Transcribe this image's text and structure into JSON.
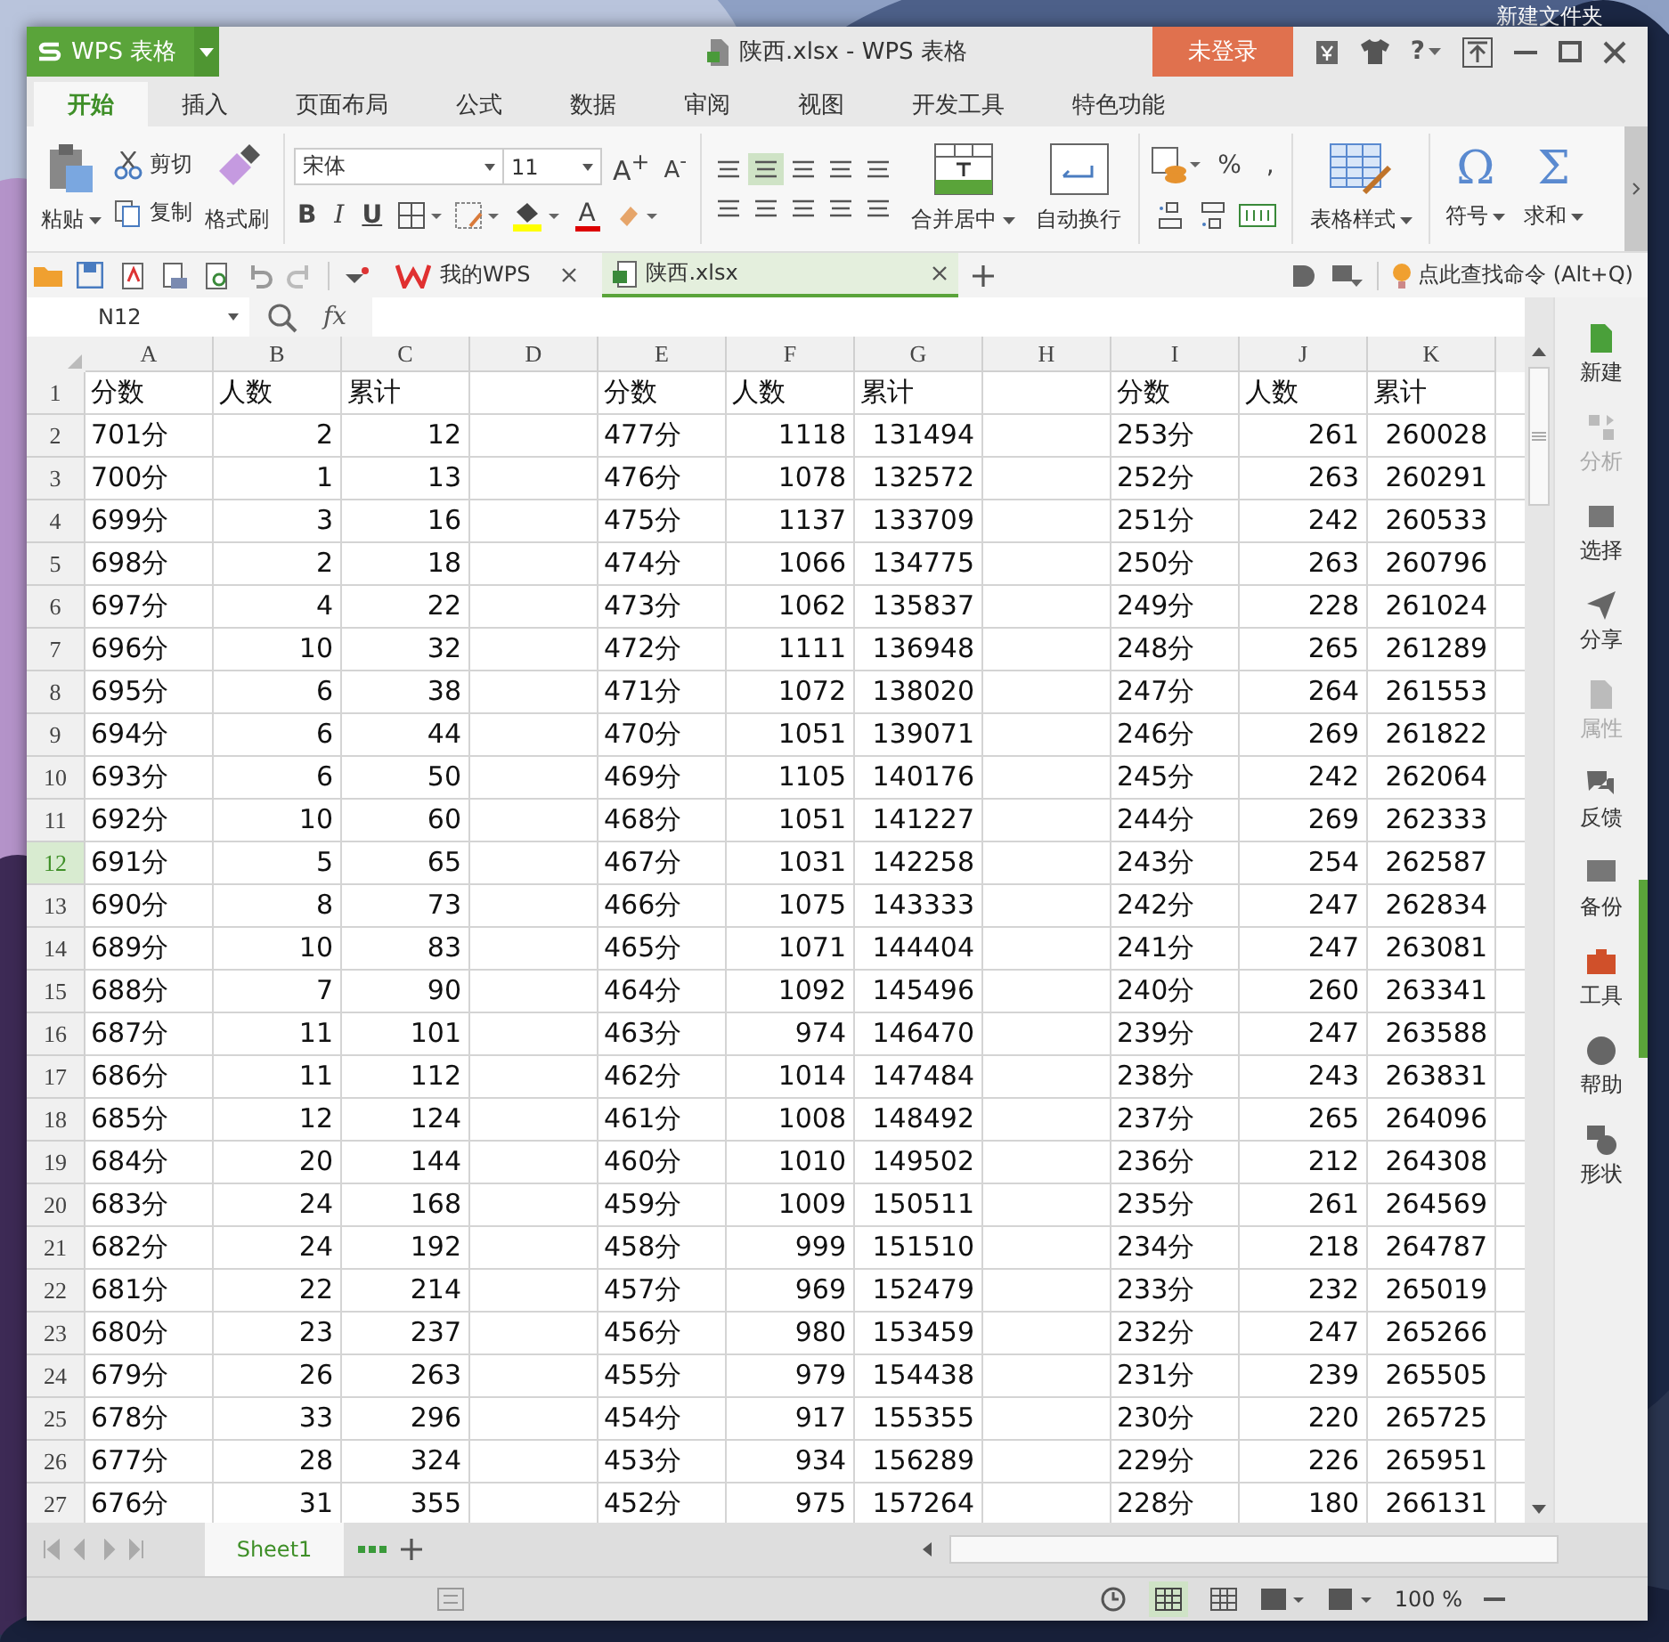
{
  "desktop": {
    "folder_label": "新建文件夹"
  },
  "window": {
    "app_button": "WPS 表格",
    "title": "陕西.xlsx - WPS 表格",
    "login": "未登录",
    "help": "?"
  },
  "ribbon_tabs": [
    {
      "label": "开始",
      "selected": true
    },
    {
      "label": "插入",
      "selected": false
    },
    {
      "label": "页面布局",
      "selected": false
    },
    {
      "label": "公式",
      "selected": false
    },
    {
      "label": "数据",
      "selected": false
    },
    {
      "label": "审阅",
      "selected": false
    },
    {
      "label": "视图",
      "selected": false
    },
    {
      "label": "开发工具",
      "selected": false
    },
    {
      "label": "特色功能",
      "selected": false
    }
  ],
  "ribbon": {
    "paste": "粘贴",
    "cut": "剪切",
    "copy": "复制",
    "format_painter": "格式刷",
    "font": "宋体",
    "font_size": "11",
    "grow": "A$^{+}$",
    "shrink": "A$^{-}$",
    "bold": "B",
    "italic": "I",
    "underline": "U",
    "font_color": "A",
    "merge": "合并居中",
    "wrap": "自动换行",
    "percent": "%",
    "comma": ",",
    "table_style": "表格样式",
    "symbol": "符号",
    "symbol_glyph": "Ω",
    "sum": "求和",
    "sum_glyph": "Σ"
  },
  "doc_tabs": [
    {
      "label": "我的WPS",
      "selected": false
    },
    {
      "label": "陕西.xlsx",
      "selected": true
    }
  ],
  "command_search": "点此查找命令 (Alt+Q)",
  "formula_bar": {
    "name_box": "N12",
    "fx": "fx"
  },
  "columns": [
    "A",
    "B",
    "C",
    "D",
    "E",
    "F",
    "G",
    "H",
    "I",
    "J",
    "K"
  ],
  "row_headers": [
    {
      "label": "1",
      "selected": false
    },
    {
      "label": "2",
      "selected": false
    },
    {
      "label": "3",
      "selected": false
    },
    {
      "label": "4",
      "selected": false
    },
    {
      "label": "5",
      "selected": false
    },
    {
      "label": "6",
      "selected": false
    },
    {
      "label": "7",
      "selected": false
    },
    {
      "label": "8",
      "selected": false
    },
    {
      "label": "9",
      "selected": false
    },
    {
      "label": "10",
      "selected": false
    },
    {
      "label": "11",
      "selected": false
    },
    {
      "label": "12",
      "selected": true
    },
    {
      "label": "13",
      "selected": false
    },
    {
      "label": "14",
      "selected": false
    },
    {
      "label": "15",
      "selected": false
    },
    {
      "label": "16",
      "selected": false
    },
    {
      "label": "17",
      "selected": false
    },
    {
      "label": "18",
      "selected": false
    },
    {
      "label": "19",
      "selected": false
    },
    {
      "label": "20",
      "selected": false
    },
    {
      "label": "21",
      "selected": false
    },
    {
      "label": "22",
      "selected": false
    },
    {
      "label": "23",
      "selected": false
    },
    {
      "label": "24",
      "selected": false
    },
    {
      "label": "25",
      "selected": false
    },
    {
      "label": "26",
      "selected": false
    },
    {
      "label": "27",
      "selected": false
    }
  ],
  "blocks": [
    {
      "headers": [
        "分数",
        "人数",
        "累计"
      ],
      "rows": [
        [
          "701分",
          "2",
          "12"
        ],
        [
          "700分",
          "1",
          "13"
        ],
        [
          "699分",
          "3",
          "16"
        ],
        [
          "698分",
          "2",
          "18"
        ],
        [
          "697分",
          "4",
          "22"
        ],
        [
          "696分",
          "10",
          "32"
        ],
        [
          "695分",
          "6",
          "38"
        ],
        [
          "694分",
          "6",
          "44"
        ],
        [
          "693分",
          "6",
          "50"
        ],
        [
          "692分",
          "10",
          "60"
        ],
        [
          "691分",
          "5",
          "65"
        ],
        [
          "690分",
          "8",
          "73"
        ],
        [
          "689分",
          "10",
          "83"
        ],
        [
          "688分",
          "7",
          "90"
        ],
        [
          "687分",
          "11",
          "101"
        ],
        [
          "686分",
          "11",
          "112"
        ],
        [
          "685分",
          "12",
          "124"
        ],
        [
          "684分",
          "20",
          "144"
        ],
        [
          "683分",
          "24",
          "168"
        ],
        [
          "682分",
          "24",
          "192"
        ],
        [
          "681分",
          "22",
          "214"
        ],
        [
          "680分",
          "23",
          "237"
        ],
        [
          "679分",
          "26",
          "263"
        ],
        [
          "678分",
          "33",
          "296"
        ],
        [
          "677分",
          "28",
          "324"
        ],
        [
          "676分",
          "31",
          "355"
        ]
      ]
    },
    {
      "headers": [
        "分数",
        "人数",
        "累计"
      ],
      "rows": [
        [
          "477分",
          "1118",
          "131494"
        ],
        [
          "476分",
          "1078",
          "132572"
        ],
        [
          "475分",
          "1137",
          "133709"
        ],
        [
          "474分",
          "1066",
          "134775"
        ],
        [
          "473分",
          "1062",
          "135837"
        ],
        [
          "472分",
          "1111",
          "136948"
        ],
        [
          "471分",
          "1072",
          "138020"
        ],
        [
          "470分",
          "1051",
          "139071"
        ],
        [
          "469分",
          "1105",
          "140176"
        ],
        [
          "468分",
          "1051",
          "141227"
        ],
        [
          "467分",
          "1031",
          "142258"
        ],
        [
          "466分",
          "1075",
          "143333"
        ],
        [
          "465分",
          "1071",
          "144404"
        ],
        [
          "464分",
          "1092",
          "145496"
        ],
        [
          "463分",
          "974",
          "146470"
        ],
        [
          "462分",
          "1014",
          "147484"
        ],
        [
          "461分",
          "1008",
          "148492"
        ],
        [
          "460分",
          "1010",
          "149502"
        ],
        [
          "459分",
          "1009",
          "150511"
        ],
        [
          "458分",
          "999",
          "151510"
        ],
        [
          "457分",
          "969",
          "152479"
        ],
        [
          "456分",
          "980",
          "153459"
        ],
        [
          "455分",
          "979",
          "154438"
        ],
        [
          "454分",
          "917",
          "155355"
        ],
        [
          "453分",
          "934",
          "156289"
        ],
        [
          "452分",
          "975",
          "157264"
        ]
      ]
    },
    {
      "headers": [
        "分数",
        "人数",
        "累计"
      ],
      "rows": [
        [
          "253分",
          "261",
          "260028"
        ],
        [
          "252分",
          "263",
          "260291"
        ],
        [
          "251分",
          "242",
          "260533"
        ],
        [
          "250分",
          "263",
          "260796"
        ],
        [
          "249分",
          "228",
          "261024"
        ],
        [
          "248分",
          "265",
          "261289"
        ],
        [
          "247分",
          "264",
          "261553"
        ],
        [
          "246分",
          "269",
          "261822"
        ],
        [
          "245分",
          "242",
          "262064"
        ],
        [
          "244分",
          "269",
          "262333"
        ],
        [
          "243分",
          "254",
          "262587"
        ],
        [
          "242分",
          "247",
          "262834"
        ],
        [
          "241分",
          "247",
          "263081"
        ],
        [
          "240分",
          "260",
          "263341"
        ],
        [
          "239分",
          "247",
          "263588"
        ],
        [
          "238分",
          "243",
          "263831"
        ],
        [
          "237分",
          "265",
          "264096"
        ],
        [
          "236分",
          "212",
          "264308"
        ],
        [
          "235分",
          "261",
          "264569"
        ],
        [
          "234分",
          "218",
          "264787"
        ],
        [
          "233分",
          "232",
          "265019"
        ],
        [
          "232分",
          "247",
          "265266"
        ],
        [
          "231分",
          "239",
          "265505"
        ],
        [
          "230分",
          "220",
          "265725"
        ],
        [
          "229分",
          "226",
          "265951"
        ],
        [
          "228分",
          "180",
          "266131"
        ]
      ]
    }
  ],
  "sidebar": [
    {
      "label": "新建",
      "disabled": false
    },
    {
      "label": "分析",
      "disabled": true
    },
    {
      "label": "选择",
      "disabled": false
    },
    {
      "label": "分享",
      "disabled": false
    },
    {
      "label": "属性",
      "disabled": true
    },
    {
      "label": "反馈",
      "disabled": false
    },
    {
      "label": "备份",
      "disabled": false
    },
    {
      "label": "工具",
      "disabled": false
    },
    {
      "label": "帮助",
      "disabled": false
    },
    {
      "label": "形状",
      "disabled": false
    }
  ],
  "sheet_tabs": [
    {
      "label": "Sheet1",
      "selected": true
    }
  ],
  "status_bar": {
    "zoom": "100 %"
  }
}
